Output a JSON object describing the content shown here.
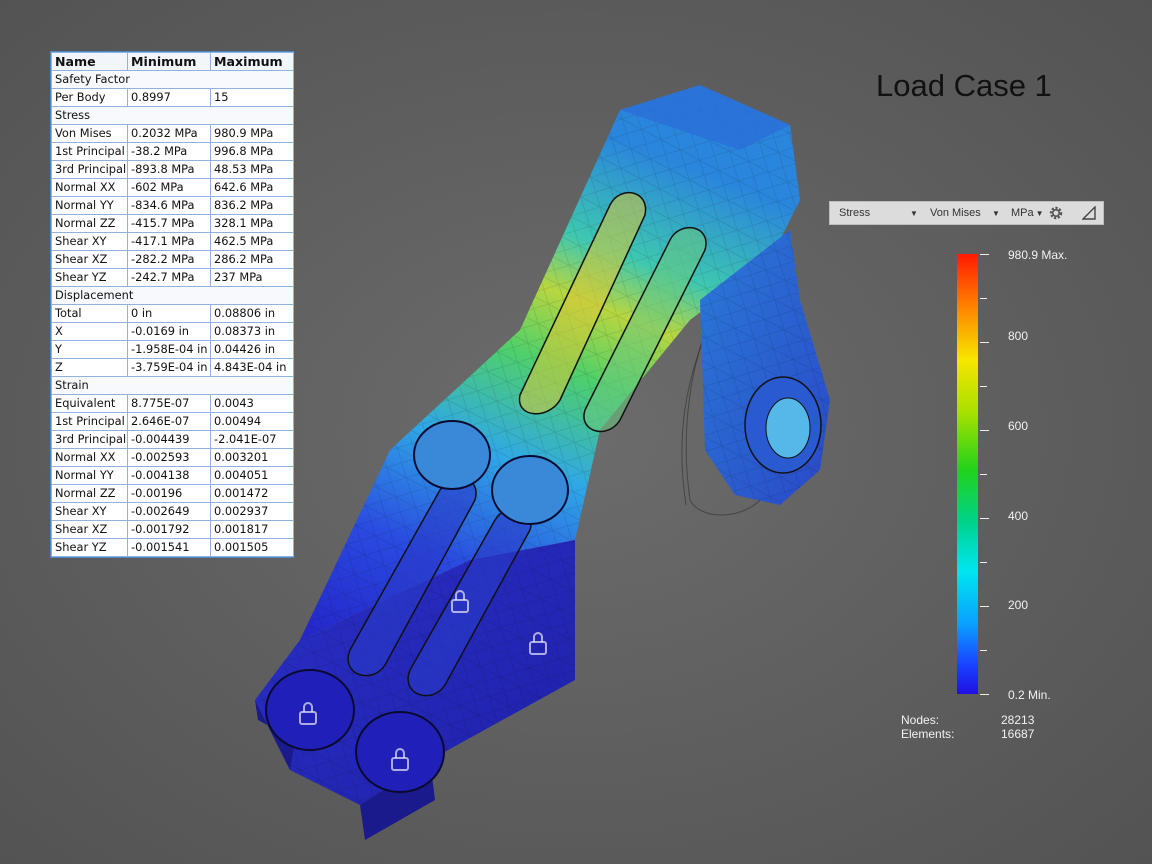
{
  "title": "Load Case 1",
  "table": {
    "headers": [
      "Name",
      "Minimum",
      "Maximum"
    ],
    "rows": [
      {
        "type": "section",
        "label": "Safety Factor"
      },
      {
        "type": "row",
        "cells": [
          "Per Body",
          "0.8997",
          "15"
        ]
      },
      {
        "type": "section",
        "label": "Stress"
      },
      {
        "type": "row",
        "cells": [
          "Von Mises",
          "0.2032 MPa",
          "980.9 MPa"
        ]
      },
      {
        "type": "row",
        "cells": [
          "1st Principal",
          "-38.2 MPa",
          "996.8 MPa"
        ]
      },
      {
        "type": "row",
        "cells": [
          "3rd Principal",
          "-893.8 MPa",
          "48.53 MPa"
        ]
      },
      {
        "type": "row",
        "cells": [
          "Normal XX",
          "-602 MPa",
          "642.6 MPa"
        ]
      },
      {
        "type": "row",
        "cells": [
          "Normal YY",
          "-834.6 MPa",
          "836.2 MPa"
        ]
      },
      {
        "type": "row",
        "cells": [
          "Normal ZZ",
          "-415.7 MPa",
          "328.1 MPa"
        ]
      },
      {
        "type": "row",
        "cells": [
          "Shear XY",
          "-417.1 MPa",
          "462.5 MPa"
        ]
      },
      {
        "type": "row",
        "cells": [
          "Shear XZ",
          "-282.2 MPa",
          "286.2 MPa"
        ]
      },
      {
        "type": "row",
        "cells": [
          "Shear YZ",
          "-242.7 MPa",
          "237 MPa"
        ]
      },
      {
        "type": "section",
        "label": "Displacement"
      },
      {
        "type": "row",
        "cells": [
          "Total",
          "0 in",
          "0.08806 in"
        ]
      },
      {
        "type": "row",
        "cells": [
          "X",
          "-0.0169 in",
          "0.08373 in"
        ]
      },
      {
        "type": "row",
        "cells": [
          "Y",
          "-1.958E-04 in",
          "0.04426 in"
        ]
      },
      {
        "type": "row",
        "cells": [
          "Z",
          "-3.759E-04 in",
          "4.843E-04 in"
        ]
      },
      {
        "type": "section",
        "label": "Strain"
      },
      {
        "type": "row",
        "cells": [
          "Equivalent",
          "8.775E-07",
          "0.0043"
        ]
      },
      {
        "type": "row",
        "cells": [
          "1st Principal",
          "2.646E-07",
          "0.00494"
        ]
      },
      {
        "type": "row",
        "cells": [
          "3rd Principal",
          "-0.004439",
          "-2.041E-07"
        ]
      },
      {
        "type": "row",
        "cells": [
          "Normal XX",
          "-0.002593",
          "0.003201"
        ]
      },
      {
        "type": "row",
        "cells": [
          "Normal YY",
          "-0.004138",
          "0.004051"
        ]
      },
      {
        "type": "row",
        "cells": [
          "Normal ZZ",
          "-0.00196",
          "0.001472"
        ]
      },
      {
        "type": "row",
        "cells": [
          "Shear XY",
          "-0.002649",
          "0.002937"
        ]
      },
      {
        "type": "row",
        "cells": [
          "Shear XZ",
          "-0.001792",
          "0.001817"
        ]
      },
      {
        "type": "row",
        "cells": [
          "Shear YZ",
          "-0.001541",
          "0.001505"
        ]
      }
    ]
  },
  "toolbar": {
    "result_type": "Stress",
    "component": "Von Mises",
    "unit": "MPa",
    "settings_icon": "gear-icon",
    "triangle_icon": "triangle-icon"
  },
  "legend": {
    "max_label": "980.9 Max.",
    "min_label": "0.2 Min.",
    "labels": [
      "800",
      "600",
      "400",
      "200"
    ],
    "gradient_colors": [
      "#ff1a00",
      "#f7e600",
      "#22d21a",
      "#00e6f0",
      "#1a3cff"
    ]
  },
  "mesh_stats": {
    "nodes_label": "Nodes:",
    "nodes_value": "28213",
    "elements_label": "Elements:",
    "elements_value": "16687"
  }
}
